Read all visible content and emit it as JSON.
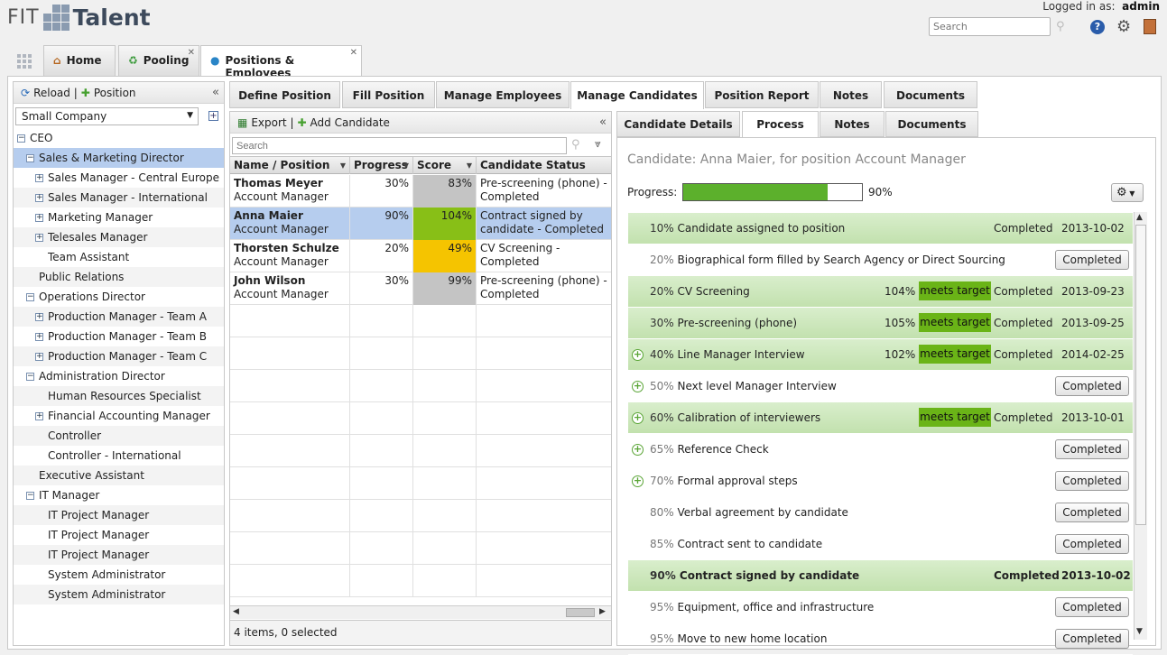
{
  "app": {
    "logo_left": "FIT",
    "logo_right": "Talent",
    "logged_in_label": "Logged in as:",
    "user": "admin",
    "search_placeholder": "Search"
  },
  "main_tabs": [
    {
      "label": "Home"
    },
    {
      "label": "Pooling"
    },
    {
      "label": "Positions & Employees"
    }
  ],
  "left": {
    "reload": "Reload |",
    "position": "Position",
    "company": "Small Company",
    "tree": [
      {
        "label": "CEO",
        "level": 0,
        "exp": "minus"
      },
      {
        "label": "Sales & Marketing Director",
        "level": 1,
        "exp": "minus",
        "selected": true
      },
      {
        "label": "Sales Manager - Central Europe",
        "level": 2,
        "exp": "plus"
      },
      {
        "label": "Sales Manager - International",
        "level": 2,
        "exp": "plus"
      },
      {
        "label": "Marketing Manager",
        "level": 2,
        "exp": "plus"
      },
      {
        "label": "Telesales Manager",
        "level": 2,
        "exp": "plus"
      },
      {
        "label": "Team Assistant",
        "level": 2,
        "exp": ""
      },
      {
        "label": "Public Relations",
        "level": 1,
        "exp": ""
      },
      {
        "label": "Operations Director",
        "level": 1,
        "exp": "minus"
      },
      {
        "label": "Production Manager - Team A",
        "level": 2,
        "exp": "plus"
      },
      {
        "label": "Production Manager - Team B",
        "level": 2,
        "exp": "plus"
      },
      {
        "label": "Production Manager - Team C",
        "level": 2,
        "exp": "plus"
      },
      {
        "label": "Administration Director",
        "level": 1,
        "exp": "minus"
      },
      {
        "label": "Human Resources Specialist",
        "level": 2,
        "exp": ""
      },
      {
        "label": "Financial Accounting Manager",
        "level": 2,
        "exp": "plus"
      },
      {
        "label": "Controller",
        "level": 2,
        "exp": ""
      },
      {
        "label": "Controller - International",
        "level": 2,
        "exp": ""
      },
      {
        "label": "Executive Assistant",
        "level": 1,
        "exp": ""
      },
      {
        "label": "IT Manager",
        "level": 1,
        "exp": "minus"
      },
      {
        "label": "IT Project Manager",
        "level": 2,
        "exp": ""
      },
      {
        "label": "IT Project Manager",
        "level": 2,
        "exp": ""
      },
      {
        "label": "IT Project Manager",
        "level": 2,
        "exp": ""
      },
      {
        "label": "System Administrator",
        "level": 2,
        "exp": ""
      },
      {
        "label": "System Administrator",
        "level": 2,
        "exp": ""
      }
    ]
  },
  "sub_tabs": [
    "Define Position",
    "Fill Position",
    "Manage Employees",
    "Manage Candidates",
    "Position Report",
    "Notes",
    "Documents"
  ],
  "candidates": {
    "export": "Export |",
    "add": "Add Candidate",
    "search_placeholder": "Search",
    "columns": [
      "Name / Position",
      "Progress",
      "Score",
      "Candidate Status"
    ],
    "rows": [
      {
        "name": "Thomas Meyer",
        "position": "Account Manager",
        "progress": "30%",
        "score": "83%",
        "score_color": "#c4c4c4",
        "status": "Pre-screening (phone) - Completed"
      },
      {
        "name": "Anna Maier",
        "position": "Account Manager",
        "progress": "90%",
        "score": "104%",
        "score_color": "#88bf17",
        "status": "Contract signed by candidate - Completed",
        "selected": true
      },
      {
        "name": "Thorsten Schulze",
        "position": "Account Manager",
        "progress": "20%",
        "score": "49%",
        "score_color": "#f5c400",
        "status": "CV Screening - Completed"
      },
      {
        "name": "John Wilson",
        "position": "Account Manager",
        "progress": "30%",
        "score": "99%",
        "score_color": "#c4c4c4",
        "status": "Pre-screening (phone) - Completed"
      }
    ],
    "footer": "4 items, 0 selected"
  },
  "detail_tabs": [
    "Candidate Details",
    "Process",
    "Notes",
    "Documents"
  ],
  "detail": {
    "title": "Candidate: Anna Maier, for position Account Manager",
    "progress_label": "Progress:",
    "progress_value": "90%",
    "progress_fraction": 0.9,
    "steps": [
      {
        "pct": "10%",
        "label": "Candidate assigned to position",
        "done": true,
        "status": "Completed",
        "date": "2013-10-02"
      },
      {
        "pct": "20%",
        "label": "Biographical form filled by Search Agency or Direct Sourcing",
        "button": "Completed"
      },
      {
        "pct": "20%",
        "label": "CV Screening",
        "done": true,
        "score": "104%",
        "meets": "meets target",
        "status": "Completed",
        "date": "2013-09-23"
      },
      {
        "pct": "30%",
        "label": "Pre-screening (phone)",
        "done": true,
        "score": "105%",
        "meets": "meets target",
        "status": "Completed",
        "date": "2013-09-25"
      },
      {
        "pct": "40%",
        "label": "Line Manager Interview",
        "done": true,
        "add": true,
        "score": "102%",
        "meets": "meets target",
        "status": "Completed",
        "date": "2014-02-25"
      },
      {
        "pct": "50%",
        "label": "Next level Manager Interview",
        "add": true,
        "button": "Completed"
      },
      {
        "pct": "60%",
        "label": "Calibration of interviewers",
        "done": true,
        "add": true,
        "meets": "meets target",
        "status": "Completed",
        "date": "2013-10-01"
      },
      {
        "pct": "65%",
        "label": "Reference Check",
        "add": true,
        "button": "Completed"
      },
      {
        "pct": "70%",
        "label": "Formal approval steps",
        "add": true,
        "button": "Completed"
      },
      {
        "pct": "80%",
        "label": "Verbal agreement by candidate",
        "button": "Completed"
      },
      {
        "pct": "85%",
        "label": "Contract sent to candidate",
        "button": "Completed"
      },
      {
        "pct": "90%",
        "label": "Contract signed by candidate",
        "done": true,
        "bold": true,
        "status": "Completed",
        "date": "2013-10-02"
      },
      {
        "pct": "95%",
        "label": "Equipment, office and infrastructure",
        "button": "Completed"
      },
      {
        "pct": "95%",
        "label": "Move to new home location",
        "button": "Completed"
      }
    ]
  }
}
